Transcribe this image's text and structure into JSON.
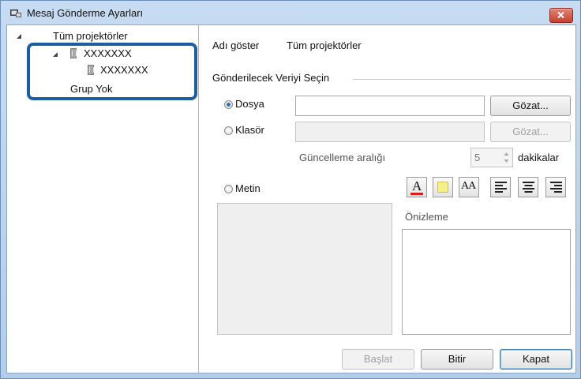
{
  "window": {
    "title": "Mesaj Gönderme Ayarları",
    "close_icon": "close-icon"
  },
  "tree": {
    "root_label": "Tüm projektörler",
    "group_label": "XXXXXXX",
    "child_label": "XXXXXXX",
    "no_group_label": "Grup Yok"
  },
  "header": {
    "show_name_label": "Adı göster",
    "show_name_value": "Tüm projektörler"
  },
  "section": {
    "title": "Gönderilecek Veriyi Seçin"
  },
  "options": {
    "file_label": "Dosya",
    "file_value": "",
    "file_browse": "Gözat...",
    "folder_label": "Klasör",
    "folder_value": "",
    "folder_browse": "Gözat...",
    "update_interval_label": "Güncelleme aralığı",
    "update_interval_value": "5",
    "minutes_label": "dakikalar",
    "text_label": "Metin",
    "selected": "file"
  },
  "text_tools": {
    "font_color_letter": "A",
    "font_size_letters": "AA"
  },
  "preview": {
    "label": "Önizleme"
  },
  "footer": {
    "start_label": "Başlat",
    "finish_label": "Bitir",
    "close_label": "Kapat"
  },
  "colors": {
    "highlight_box": "#1c5ea2",
    "font_color_bar": "#d02020",
    "highlight_color_fill": "#f5f08a"
  }
}
